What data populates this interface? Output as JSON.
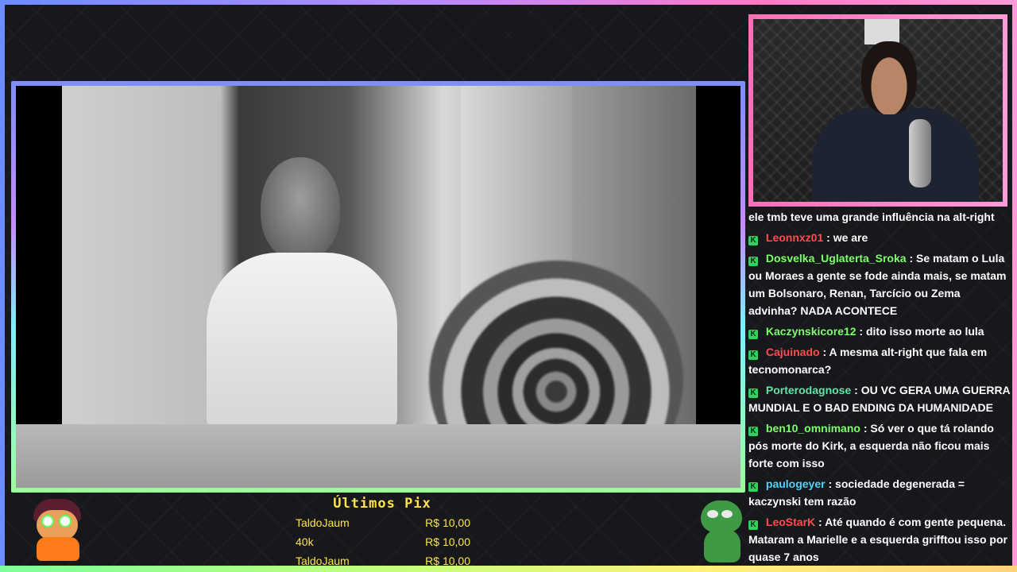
{
  "stream": {
    "tips": {
      "title": "Últimos Pix",
      "rows": [
        {
          "name": "TaldoJaum",
          "amount": "R$ 10,00"
        },
        {
          "name": "40k",
          "amount": "R$ 10,00"
        },
        {
          "name": "TaldoJaum",
          "amount": "R$ 10,00"
        }
      ]
    },
    "chat": {
      "messages": [
        {
          "user": "",
          "color": "#ffffff",
          "text": "ele tmb teve uma grande influência na alt-right"
        },
        {
          "user": "Leonnxz01",
          "color": "#ff4d4d",
          "text": "we are"
        },
        {
          "user": "Dosvelka_Uglaterta_Sroka",
          "color": "#7dff6a",
          "text": "Se matam o Lula ou Moraes a gente se fode ainda mais, se matam um Bolsonaro, Renan, Tarcício ou Zema advinha? NADA ACONTECE"
        },
        {
          "user": "Kaczynskicore12",
          "color": "#7dff6a",
          "text": "dito isso morte ao lula"
        },
        {
          "user": "Cajuinado",
          "color": "#ff4d4d",
          "text": "A mesma alt-right que fala em tecnomonarca?"
        },
        {
          "user": "Porterodagnose",
          "color": "#62e3a6",
          "text": "OU VC GERA UMA GUERRA MUNDIAL E O BAD ENDING DA HUMANIDADE"
        },
        {
          "user": "ben10_omnimano",
          "color": "#7dff6a",
          "text": "Só ver o que tá rolando pós morte do Kirk, a esquerda não ficou mais forte com isso"
        },
        {
          "user": "paulogeyer",
          "color": "#4fd2ff",
          "text": "sociedade degenerada = kaczynski tem razão"
        },
        {
          "user": "LeoStarK",
          "color": "#ff4d4d",
          "text": "Até quando é com gente pequena. Mataram a Marielle e a esquerda grifftou isso por quase 7 anos"
        }
      ]
    }
  }
}
